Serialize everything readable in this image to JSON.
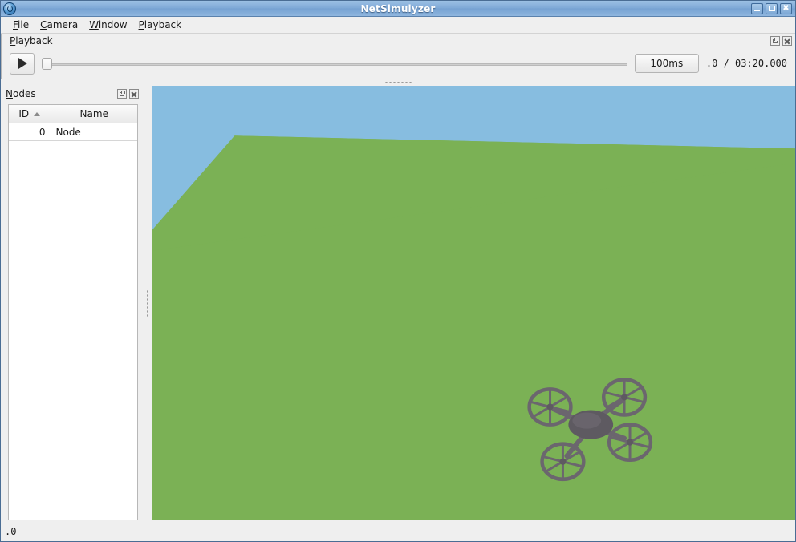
{
  "window": {
    "title": "NetSimulyzer",
    "app_icon": "netsimulyzer-logo-icon",
    "controls": {
      "minimize": "minimize-button",
      "maximize": "maximize-button",
      "close": "close-button"
    }
  },
  "menubar": {
    "items": [
      {
        "label": "File",
        "accelerator": "F"
      },
      {
        "label": "Camera",
        "accelerator": "C"
      },
      {
        "label": "Window",
        "accelerator": "W"
      },
      {
        "label": "Playback",
        "accelerator": "P"
      }
    ]
  },
  "playback_dock": {
    "title": "Playback",
    "title_accelerator": "P",
    "float_button_label": "float-playback-dock",
    "close_button_label": "close-playback-dock",
    "play_button_label": "play",
    "slider": {
      "value": 0,
      "min": 0,
      "max": 200000,
      "handle_position_percent": 0
    },
    "granularity_label": "100ms",
    "time_readout": ".0 / 03:20.000",
    "current_time": ".0",
    "total_time": "03:20.000"
  },
  "nodes_dock": {
    "title": "Nodes",
    "title_accelerator": "N",
    "float_button_label": "float-nodes-dock",
    "close_button_label": "close-nodes-dock",
    "table": {
      "columns": [
        {
          "key": "id",
          "label": "ID",
          "sorted": "asc",
          "sort_glyph": "▲"
        },
        {
          "key": "name",
          "label": "Name",
          "sorted": "none",
          "sort_glyph": ""
        }
      ],
      "rows": [
        {
          "id": "0",
          "name": "Node"
        }
      ]
    }
  },
  "viewport": {
    "name": "3d-scene-viewport",
    "sky_color": "#87bde0",
    "ground_color": "#7bb155",
    "ground_shadow_color": "#74a850",
    "drone": {
      "label": "quadcopter-drone-model",
      "body_color": "#5e5a61",
      "body_highlight": "#6e6a72",
      "rotor_color": "#6b666e",
      "rotor_count": 4,
      "blades_per_rotor": 6
    }
  },
  "statusbar": {
    "text": ".0"
  }
}
